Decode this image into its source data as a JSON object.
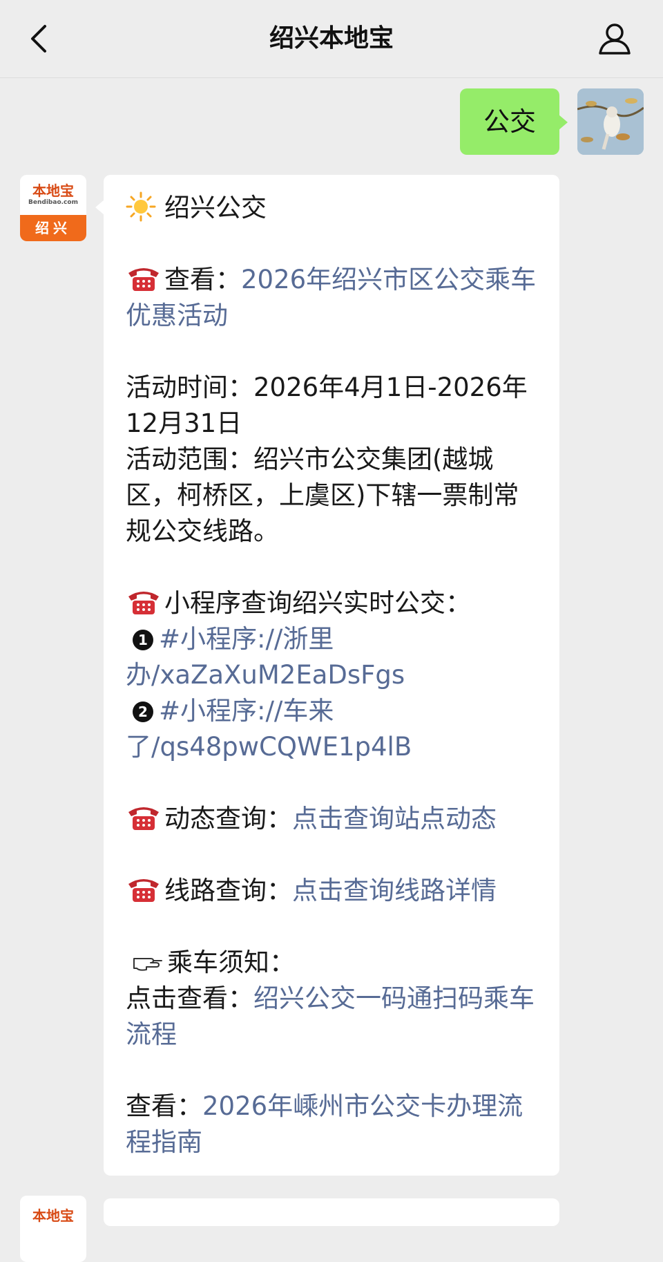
{
  "header": {
    "title": "绍兴本地宝",
    "back_icon": "chevron-left-icon",
    "profile_icon": "person-icon"
  },
  "outgoing": {
    "text": "公交",
    "bubble_color": "#95ec69"
  },
  "bot": {
    "avatar_brand": "本地宝",
    "avatar_site": "Bendibao.com",
    "avatar_city": "绍兴",
    "brand_color": "#f06a1b"
  },
  "message": {
    "heading": "绍兴公交",
    "item1_prefix": "查看：",
    "item1_link": "2026年绍兴市区公交乘车优惠活动",
    "activity_time": "活动时间：2026年4月1日-2026年12月31日",
    "activity_scope": "活动范围：绍兴市公交集团(越城区，柯桥区，上虞区)下辖一票制常规公交线路。",
    "mini_heading": "小程序查询绍兴实时公交：",
    "mini1_num": "1",
    "mini1_link": "#小程序://浙里办/xaZaXuM2EaDsFgs",
    "mini2_num": "2",
    "mini2_link": "#小程序://车来了/qs48pwCQWE1p4lB",
    "dynamic_prefix": "动态查询：",
    "dynamic_link": "点击查询站点动态",
    "route_prefix": "线路查询：",
    "route_link": "点击查询线路详情",
    "notice_heading": "乘车须知：",
    "notice_prefix": "点击查看：",
    "notice_link": "绍兴公交一码通扫码乘车流程",
    "last_prefix": "查看：",
    "last_link": "2026年嵊州市公交卡办理流程指南",
    "link_color": "#576b95"
  }
}
